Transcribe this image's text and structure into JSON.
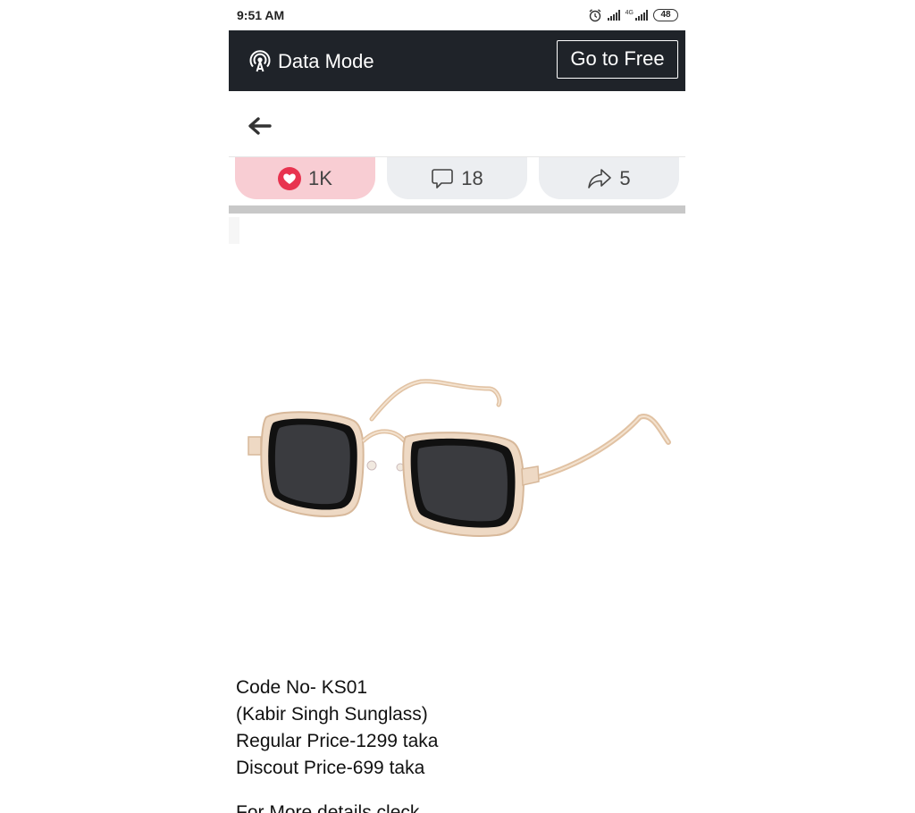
{
  "status_bar": {
    "time": "9:51 AM",
    "network_label": "4G",
    "battery": "48"
  },
  "data_mode": {
    "label": "Data Mode",
    "button": "Go to Free"
  },
  "reactions": {
    "likes": "1K",
    "comments": "18",
    "shares": "5"
  },
  "post": {
    "lines": [
      "Code No- KS01",
      "(Kabir Singh Sunglass)",
      "Regular Price-1299 taka",
      "Discout Price-699 taka"
    ],
    "partial_line": "For More details cleck"
  },
  "colors": {
    "top_bar": "#1f2329",
    "like_pill": "#f8cdd3",
    "heart": "#e8334f",
    "pill": "#eceef1"
  },
  "icons": {
    "data": "broadcast-icon",
    "back": "arrow-left-icon",
    "like": "heart-icon",
    "comment": "comment-bubble-icon",
    "share": "share-arrow-icon"
  }
}
